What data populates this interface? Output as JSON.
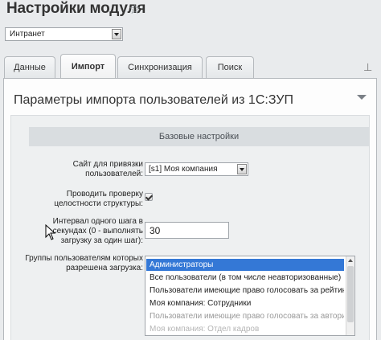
{
  "header": {
    "title": "Настройки модуля",
    "star_icon": "star-icon"
  },
  "site_select": {
    "value": "Интранет"
  },
  "tabs": [
    {
      "label": "Данные",
      "active": false
    },
    {
      "label": "Импорт",
      "active": true
    },
    {
      "label": "Синхронизация",
      "active": false
    },
    {
      "label": "Поиск",
      "active": false
    }
  ],
  "panel": {
    "title": "Параметры импорта пользователей из 1С:ЗУП",
    "section_title": "Базовые настройки"
  },
  "form": {
    "site_label": "Сайт для привязки пользователей:",
    "site_value": "[s1] Моя компания",
    "check_label": "Проводить проверку целостности структуры:",
    "check_checked": true,
    "interval_label": "Интервал одного шага в секундах (0 - выполнять загрузку за один шаг):",
    "interval_value": "30",
    "groups_label": "Группы пользователям которых разрешена загрузка:",
    "groups": [
      "Администраторы",
      "Все пользователи (в том числе неавторизованные)",
      "Пользователи имеющие право голосовать за рейтинг",
      "Моя компания: Сотрудники",
      "Пользователи имеющие право голосовать за авторитет",
      "Моя компания: Отдел кадров"
    ],
    "groups_selected_index": 0
  },
  "colors": {
    "selected_bg": "#3478d6",
    "panel_bg": "#eef0f1",
    "section_bg": "#d9dde0"
  }
}
